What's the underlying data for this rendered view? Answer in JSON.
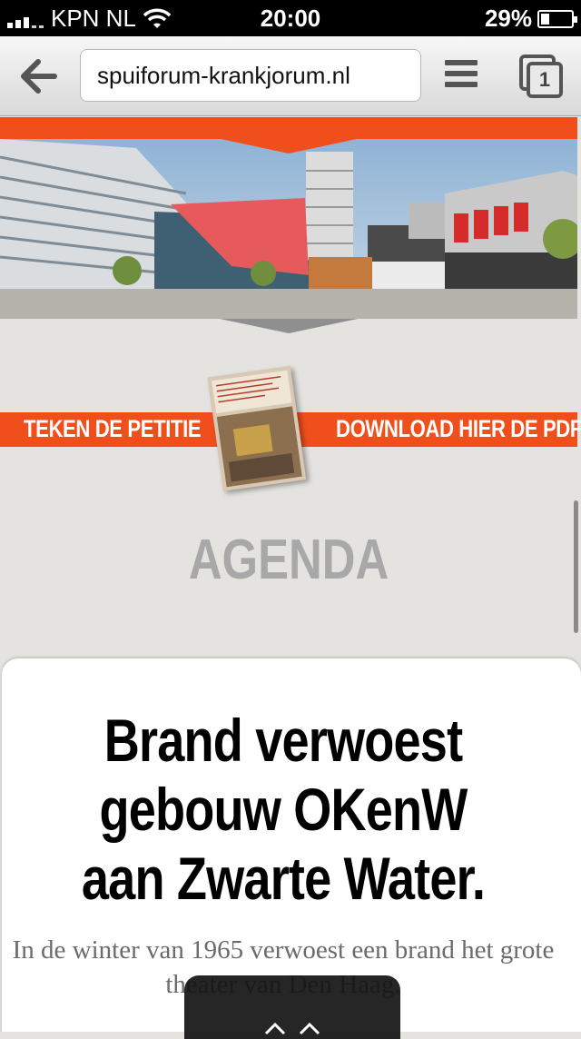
{
  "status_bar": {
    "carrier": "KPN NL",
    "time": "20:00",
    "battery": "29%",
    "battery_level": 0.29
  },
  "browser": {
    "url": "spuiforum-krankjorum.nl",
    "tab_count": "1",
    "icons": {
      "back": "back-arrow-icon",
      "menu": "menu-icon",
      "tabs": "tabs-icon"
    }
  },
  "page": {
    "petition_left": "TEKEN DE PETITIE",
    "petition_right": "DOWNLOAD HIER DE PDF",
    "agenda_heading": "AGENDA",
    "article": {
      "title": "Brand verwoest gebouw OKenW aan Zwarte Water.",
      "excerpt": "In de winter van 1965 verwoest een brand het grote theater van Den Haag."
    }
  },
  "colors": {
    "accent": "#f04f1c",
    "background": "#e4e3e0",
    "agenda_text": "#a8a8a8"
  }
}
